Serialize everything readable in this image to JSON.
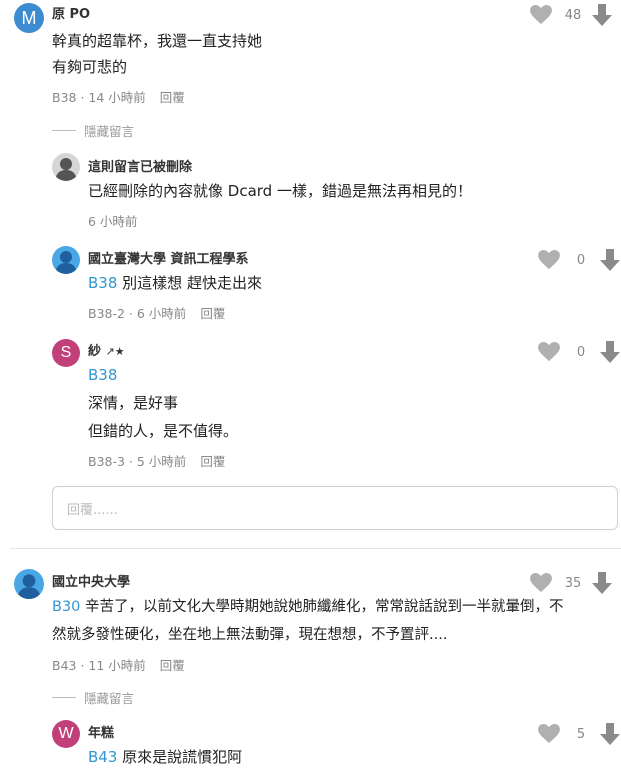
{
  "comments": [
    {
      "avatar_letter": "M",
      "avatar_color": "#3d8bd1",
      "author": "原 PO",
      "lines": [
        "幹真的超靠杯，我還一直支持她",
        "有夠可悲的"
      ],
      "floor": "B38",
      "time": "14 小時前",
      "reply_label": "回覆",
      "likes": "48",
      "hide_label": "隱藏留言",
      "replies": [
        {
          "author": "這則留言已被刪除",
          "lines": [
            "已經刪除的內容就像 Dcard 一樣，錯過是無法再相見的！"
          ],
          "time": "6 小時前",
          "avatar": "deleted-user"
        },
        {
          "author": "國立臺灣大學 資訊工程學系",
          "mention": "B38",
          "lines": [
            "別這樣想 趕快走出來"
          ],
          "floor": "B38-2",
          "time": "6 小時前",
          "reply_label": "回覆",
          "likes": "0",
          "avatar": "school-default",
          "avatar_color": "#4aa7e6"
        },
        {
          "author": "紗 ",
          "author_suffix": "↗★",
          "avatar_letter": "S",
          "avatar_color": "#c2407a",
          "mention": "B38",
          "lines": [
            "深情，是好事",
            "但錯的人，是不值得。"
          ],
          "floor": "B38-3",
          "time": "5 小時前",
          "reply_label": "回覆",
          "likes": "0"
        }
      ],
      "reply_placeholder": "回覆......"
    },
    {
      "author": "國立中央大學",
      "avatar": "school-default",
      "avatar_color": "#4aa7e6",
      "mention": "B30",
      "lines": [
        "辛苦了，以前文化大學時期她說她肺纖維化，常常說話說到一半就暈倒，不",
        "然就多發性硬化，坐在地上無法動彈，現在想想，不予置評...."
      ],
      "floor": "B43",
      "time": "11 小時前",
      "reply_label": "回覆",
      "likes": "35",
      "hide_label": "隱藏留言",
      "replies": [
        {
          "author": "年糕",
          "avatar_letter": "W",
          "avatar_color": "#c2407a",
          "mention": "B43",
          "lines": [
            "原來是說謊慣犯阿"
          ],
          "likes": "5"
        }
      ]
    }
  ],
  "icons": {
    "like": "heart-icon",
    "dislike": "down-arrow-icon",
    "default_avatar": "person-silhouette-icon"
  },
  "colors": {
    "link": "#3397cf",
    "icon_gray": "#b0b0b0",
    "arrow_gray": "#8a8a8a"
  }
}
